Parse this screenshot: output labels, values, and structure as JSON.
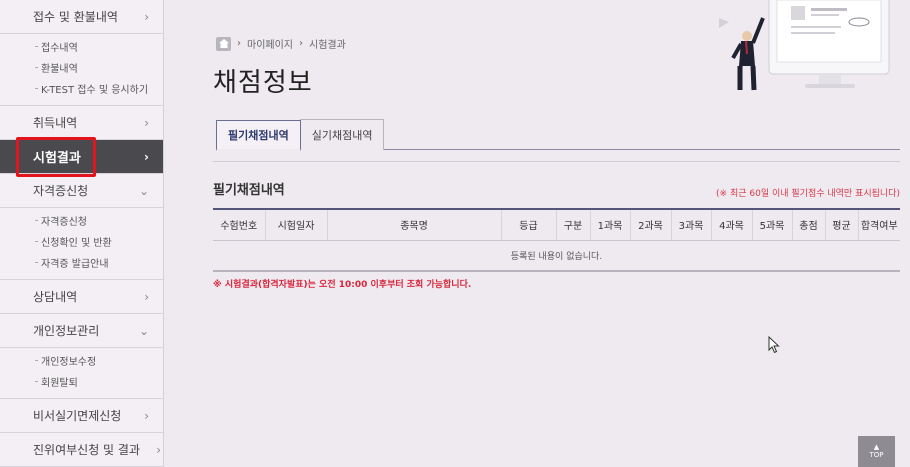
{
  "sidebar": {
    "groups": [
      {
        "label": "접수 및 환불내역",
        "items": [
          "접수내역",
          "환불내역",
          "K-TEST 접수 및 응시하기"
        ]
      },
      {
        "label": "취득내역",
        "items": []
      },
      {
        "label": "시험결과",
        "active": true,
        "items": []
      },
      {
        "label": "자격증신청",
        "items": [
          "자격증신청",
          "신청확인 및 반환",
          "자격증 발급안내"
        ]
      },
      {
        "label": "상담내역",
        "items": []
      },
      {
        "label": "개인정보관리",
        "items": [
          "개인정보수정",
          "회원탈퇴"
        ]
      },
      {
        "label": "비서실기면제신청",
        "items": []
      },
      {
        "label": "진위여부신청 및 결과",
        "items": []
      }
    ],
    "chevron_right": "›",
    "chevron_down": "⌄"
  },
  "breadcrumb": {
    "sep": "›",
    "items": [
      "마이페이지",
      "시험결과"
    ]
  },
  "page_title": "채점정보",
  "tabs": [
    "필기채점내역",
    "실기채점내역"
  ],
  "section_title": "필기채점내역",
  "notice_top": "(※ 최근 60일 이내 필기점수 내역만 표시됩니다)",
  "table": {
    "columns": [
      "수험번호",
      "시험일자",
      "종목명",
      "등급",
      "구분",
      "1과목",
      "2과목",
      "3과목",
      "4과목",
      "5과목",
      "총점",
      "평균",
      "합격여부"
    ],
    "empty_message": "등록된 내용이 없습니다."
  },
  "notice_bottom": "※ 시험결과(합격자발표)는 오전 10:00 이후부터 조회 가능합니다.",
  "top_button": "TOP",
  "colors": {
    "active_menu": "#4a4a4e",
    "highlight": "#e1151b",
    "notice": "#d8384a"
  }
}
